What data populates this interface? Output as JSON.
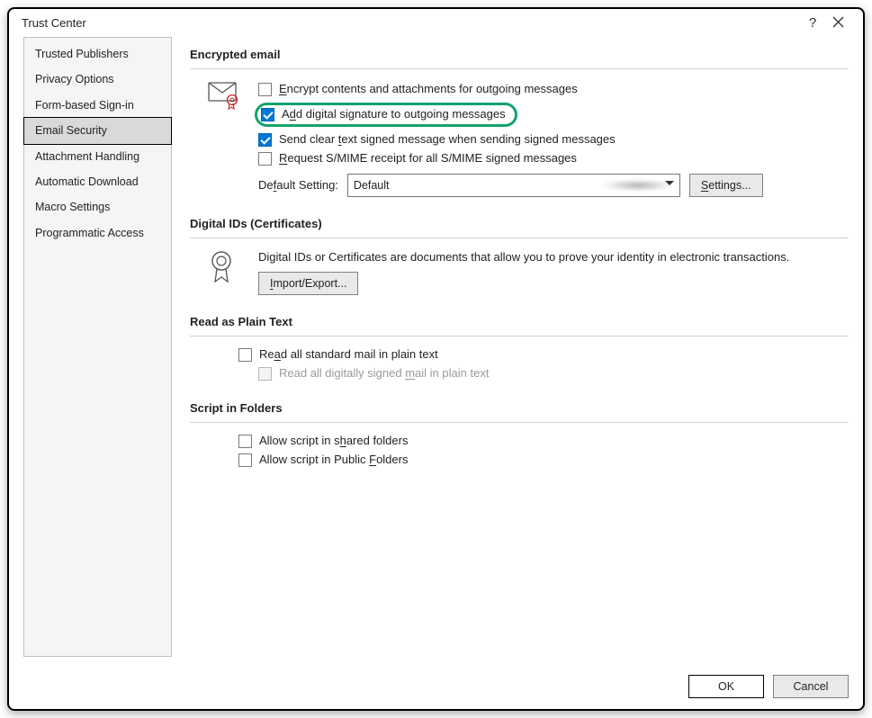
{
  "window": {
    "title": "Trust Center"
  },
  "sidebar": {
    "items": [
      {
        "label": "Trusted Publishers"
      },
      {
        "label": "Privacy Options"
      },
      {
        "label": "Form-based Sign-in"
      },
      {
        "label": "Email Security"
      },
      {
        "label": "Attachment Handling"
      },
      {
        "label": "Automatic Download"
      },
      {
        "label": "Macro Settings"
      },
      {
        "label": "Programmatic Access"
      }
    ],
    "selected_index": 3
  },
  "sections": {
    "encrypted": {
      "heading": "Encrypted email",
      "options": {
        "encrypt": {
          "prefix": "",
          "ul": "E",
          "rest": "ncrypt contents and attachments for outgoing messages",
          "checked": false
        },
        "sign": {
          "prefix": "A",
          "ul": "d",
          "rest": "d digital signature to outgoing messages",
          "checked": true
        },
        "clear": {
          "prefix": "Send clear ",
          "ul": "t",
          "rest": "ext signed message when sending signed messages",
          "checked": true
        },
        "receipt": {
          "prefix": "",
          "ul": "R",
          "rest": "equest S/MIME receipt for all S/MIME signed messages",
          "checked": false
        }
      },
      "default_label_prefix": "De",
      "default_label_ul": "f",
      "default_label_rest": "ault Setting:",
      "default_value": "Default",
      "settings_btn_ul": "S",
      "settings_btn_rest": "ettings..."
    },
    "digitalids": {
      "heading": "Digital IDs (Certificates)",
      "description": "Digital IDs or Certificates are documents that allow you to prove your identity in electronic transactions.",
      "import_btn_ul": "I",
      "import_btn_rest": "mport/Export..."
    },
    "plaintext": {
      "heading": "Read as Plain Text",
      "read_all": {
        "prefix": "Re",
        "ul": "a",
        "rest": "d all standard mail in plain text",
        "checked": false
      },
      "read_signed": {
        "prefix": "Read all digitally signed ",
        "ul": "m",
        "rest": "ail in plain text",
        "checked": false,
        "disabled": true
      }
    },
    "script": {
      "heading": "Script in Folders",
      "shared": {
        "prefix": "Allow script in s",
        "ul": "h",
        "rest": "ared folders",
        "checked": false
      },
      "public": {
        "prefix": "Allow script in Public ",
        "ul": "F",
        "rest": "olders",
        "checked": false
      }
    }
  },
  "buttons": {
    "ok": "OK",
    "cancel": "Cancel"
  }
}
